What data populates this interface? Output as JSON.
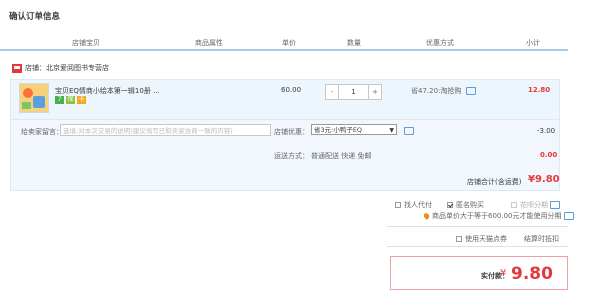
{
  "page": {
    "title": "确认订单信息"
  },
  "header": {
    "columns": [
      "店铺宝贝",
      "商品属性",
      "单价",
      "数量",
      "优惠方式",
      "小计"
    ]
  },
  "shop": {
    "label": "店铺：北京爱阅图书专营店"
  },
  "item": {
    "name": "宝贝EQ情商小绘本第一辑10册 ...",
    "price": "60.00",
    "quantity": "1",
    "minus": "-",
    "plus": "+",
    "discount": "省47.20:淘抢购",
    "subtotal": "12.80",
    "badges": [
      {
        "text": "7",
        "color": "#4caf50"
      },
      {
        "text": "保",
        "color": "#8bc34a"
      },
      {
        "text": "卡",
        "color": "#f5a623"
      }
    ]
  },
  "message": {
    "label": "给卖家留言：",
    "placeholder": "选填:对本次交易的说明(建议填写已和卖家协商一致的内容)"
  },
  "coupon": {
    "label": "店铺优惠：",
    "selected": "省3元:小鸭子EQ",
    "amount": "-3.00"
  },
  "shipping": {
    "label": "运送方式：",
    "options": "普通配送 快递 免邮",
    "amount": "0.00"
  },
  "shop_total": {
    "label": "店铺合计(含运费)",
    "amount": "¥9.80"
  },
  "options": {
    "proxy_pay": "找人代付",
    "anonymous": "匿名购买",
    "installment": "花呗分期",
    "installment_note": "商品单价大于等于600.00元才能使用分期",
    "tmall_points": "使用天猫点券",
    "points_note": "结算时抵扣"
  },
  "payment": {
    "label": "实付款：",
    "yen": "¥",
    "amount": "9.80"
  }
}
